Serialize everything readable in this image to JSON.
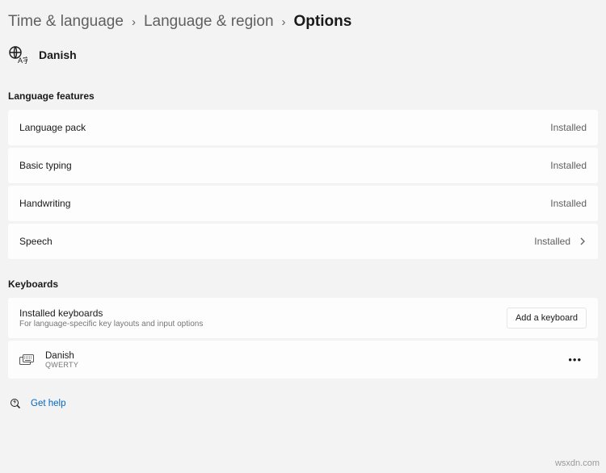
{
  "breadcrumb": {
    "items": [
      "Time & language",
      "Language & region",
      "Options"
    ],
    "current_index": 2
  },
  "language": {
    "name": "Danish"
  },
  "sections": {
    "features": {
      "title": "Language features",
      "items": [
        {
          "label": "Language pack",
          "status": "Installed",
          "has_chevron": false
        },
        {
          "label": "Basic typing",
          "status": "Installed",
          "has_chevron": false
        },
        {
          "label": "Handwriting",
          "status": "Installed",
          "has_chevron": false
        },
        {
          "label": "Speech",
          "status": "Installed",
          "has_chevron": true
        }
      ]
    },
    "keyboards": {
      "title": "Keyboards",
      "header": {
        "title": "Installed keyboards",
        "subtitle": "For language-specific key layouts and input options",
        "add_button": "Add a keyboard"
      },
      "items": [
        {
          "name": "Danish",
          "layout": "QWERTY"
        }
      ]
    }
  },
  "help": {
    "label": "Get help"
  },
  "watermark": "wsxdn.com"
}
